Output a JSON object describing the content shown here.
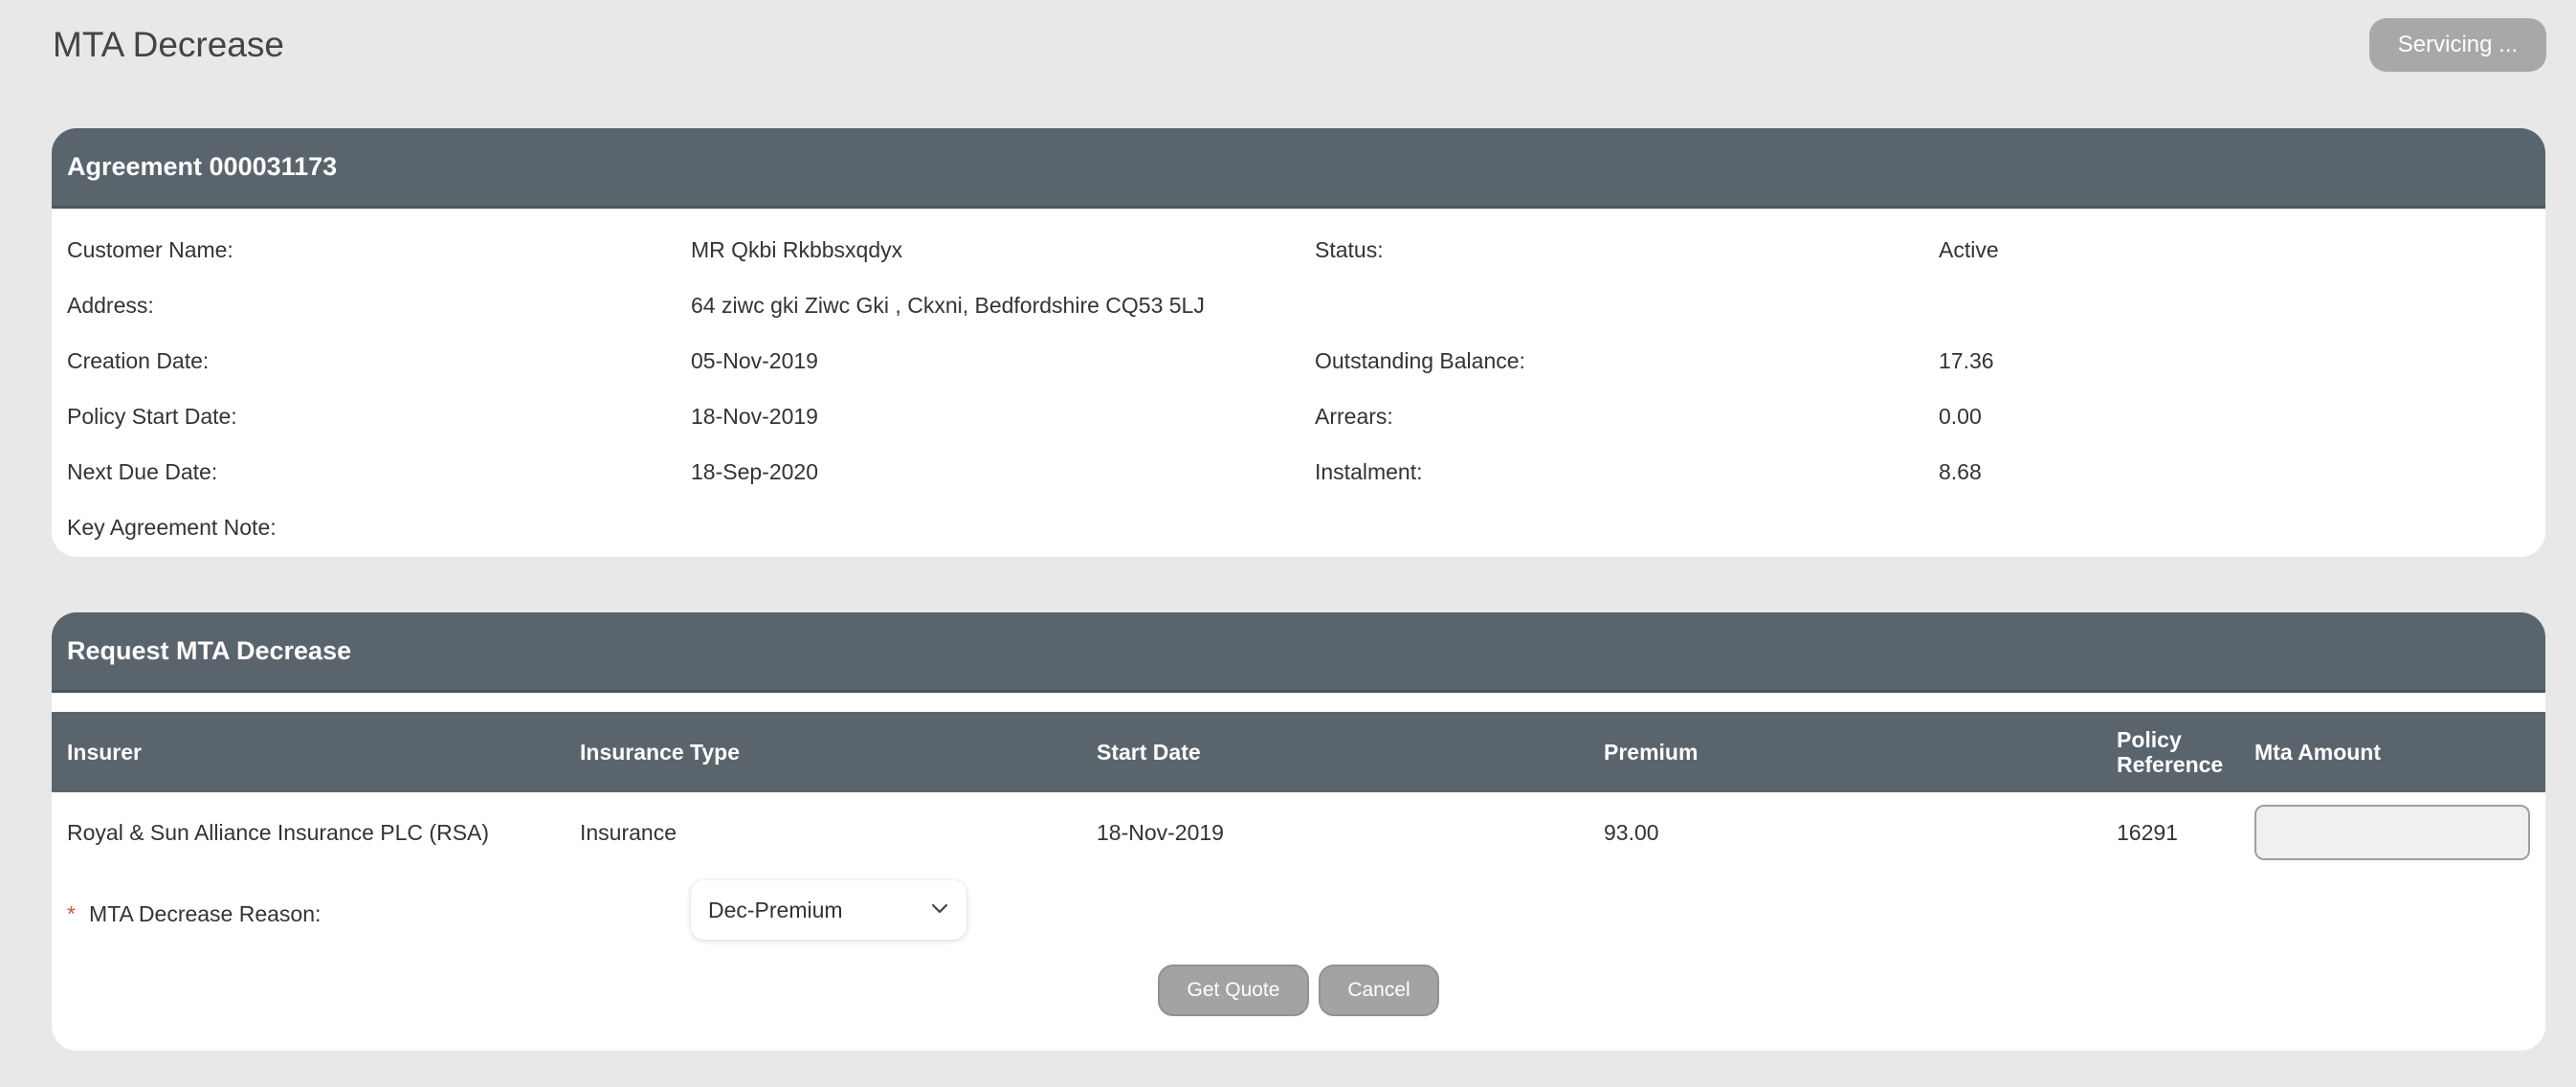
{
  "page": {
    "title": "MTA Decrease",
    "servicing_label": "Servicing ..."
  },
  "agreement": {
    "header": "Agreement 000031173",
    "fields": {
      "customer_name_label": "Customer Name:",
      "customer_name_value": "MR Qkbi Rkbbsxqdyx",
      "status_label": "Status:",
      "status_value": "Active",
      "address_label": "Address:",
      "address_value": "64 ziwc gki Ziwc Gki , Ckxni, Bedfordshire CQ53 5LJ",
      "creation_date_label": "Creation Date:",
      "creation_date_value": "05-Nov-2019",
      "outstanding_balance_label": "Outstanding Balance:",
      "outstanding_balance_value": "17.36",
      "policy_start_label": "Policy Start Date:",
      "policy_start_value": "18-Nov-2019",
      "arrears_label": "Arrears:",
      "arrears_value": "0.00",
      "next_due_label": "Next Due Date:",
      "next_due_value": "18-Sep-2020",
      "instalment_label": "Instalment:",
      "instalment_value": "8.68",
      "key_note_label": "Key Agreement Note:"
    }
  },
  "request": {
    "header": "Request MTA Decrease",
    "columns": {
      "insurer": "Insurer",
      "insurance_type": "Insurance Type",
      "start_date": "Start Date",
      "premium": "Premium",
      "policy_reference_line1": "Policy",
      "policy_reference_line2": "Reference",
      "mta_amount": "Mta Amount"
    },
    "row": {
      "insurer": "Royal & Sun Alliance Insurance PLC (RSA)",
      "insurance_type": "Insurance",
      "start_date": "18-Nov-2019",
      "premium": "93.00",
      "policy_reference": "16291",
      "mta_amount": ""
    },
    "reason": {
      "required_marker": "*",
      "label": "MTA Decrease Reason:",
      "selected": "Dec-Premium"
    },
    "buttons": {
      "get_quote": "Get Quote",
      "cancel": "Cancel"
    }
  },
  "colors": {
    "panel_header": "#5a646c",
    "page_bg": "#e8e8e8",
    "button_gray": "#a3a3a3",
    "required": "#d9534f"
  },
  "icons": {
    "select_chevron": "chevron-down-icon"
  }
}
